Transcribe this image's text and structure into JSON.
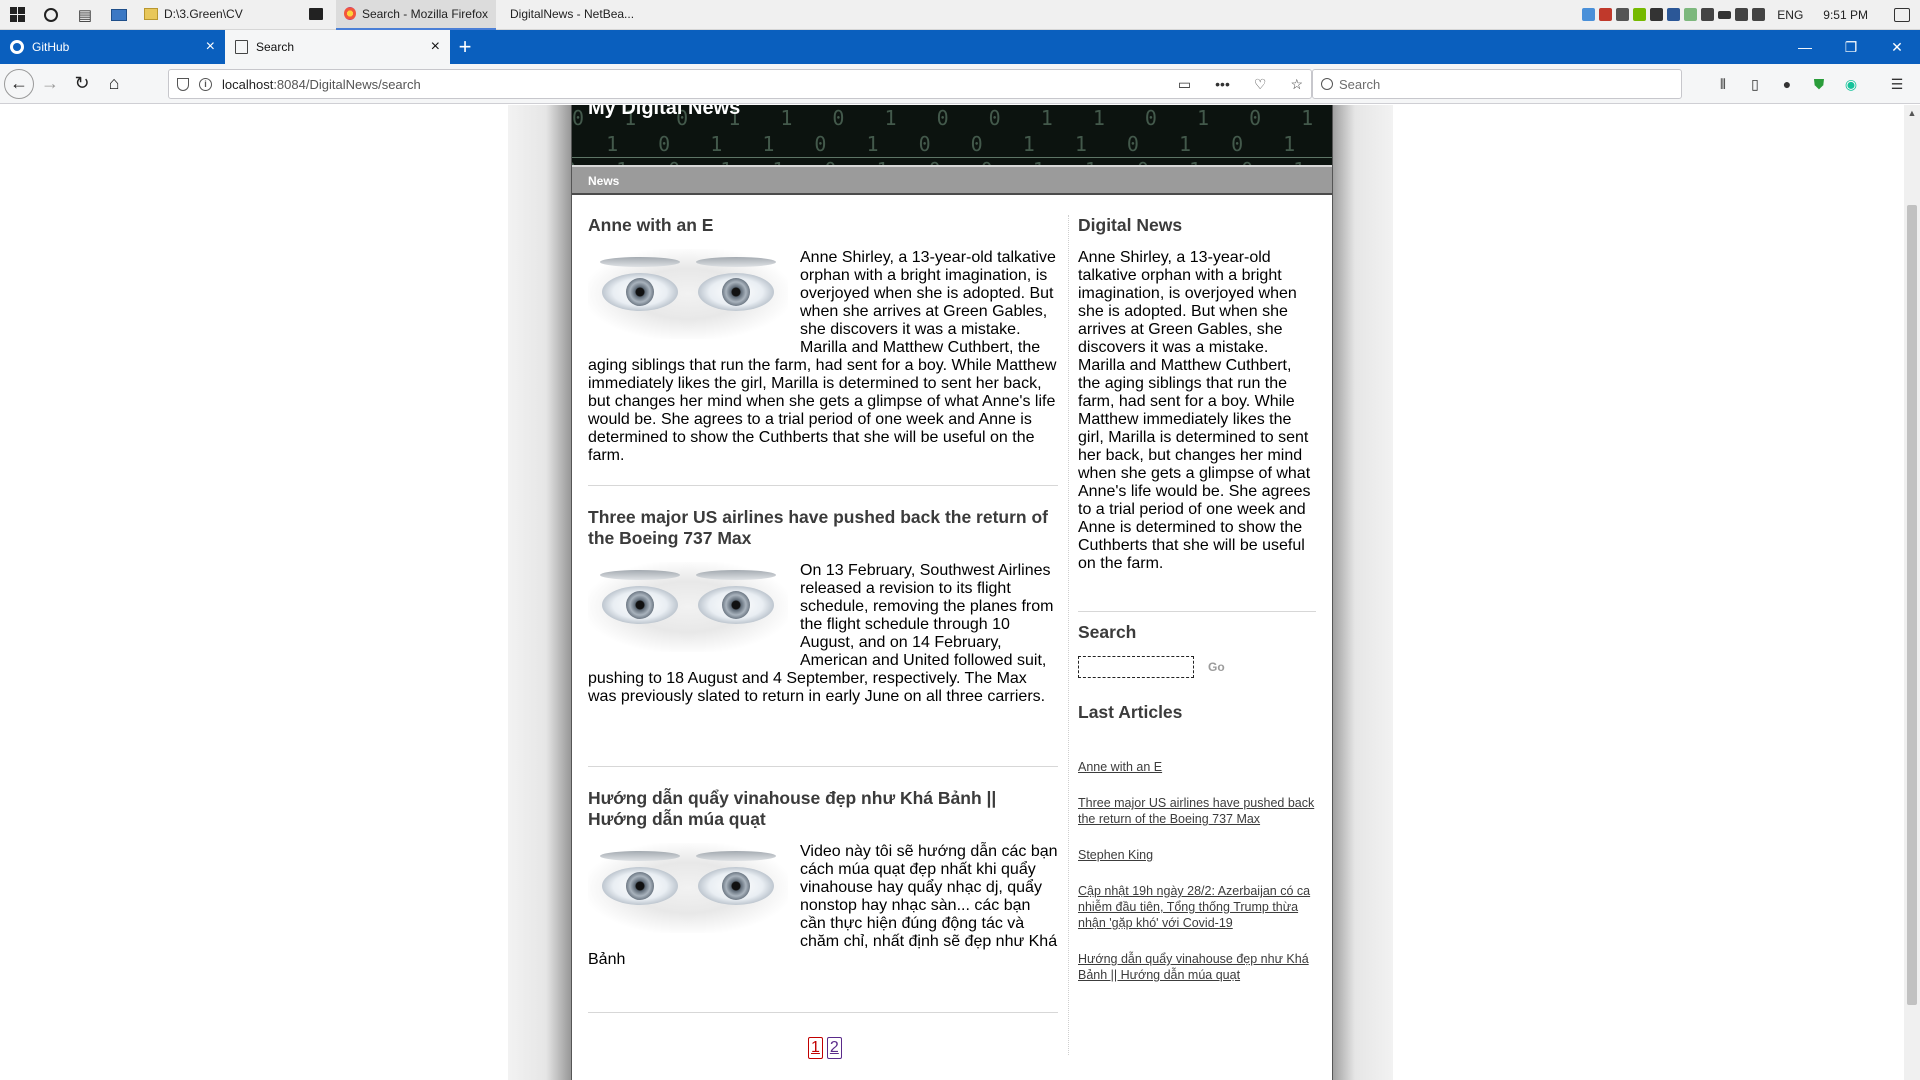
{
  "taskbar": {
    "tasks": [
      {
        "label": "D:\\3.Green\\CV"
      },
      {
        "label": ""
      },
      {
        "label": "Search - Mozilla Firefox"
      },
      {
        "label": "DigitalNews - NetBea..."
      }
    ],
    "language": "ENG",
    "time": "9:51 PM"
  },
  "browser": {
    "tabs": [
      {
        "label": "GitHub",
        "close": "×"
      },
      {
        "label": "Search",
        "close": "×"
      }
    ],
    "new_tab": "+",
    "window_controls": {
      "minimize": "—",
      "restore": "❐",
      "close": "✕"
    },
    "url_host": "localhost",
    "url_rest": ":8084/DigitalNews/search",
    "search_placeholder": "Search"
  },
  "site": {
    "title": "My Digital News",
    "header_pattern": "0 1 0 1 1 0 1 0 0 1 1 0 1 0 1 1 0 1 0 0 1 0 1 1 0",
    "menu": {
      "news": "News"
    }
  },
  "articles": [
    {
      "title": "Anne with an E",
      "text": "Anne Shirley, a 13-year-old talkative orphan with a bright imagination, is overjoyed when she is adopted. But when she arrives at Green Gables, she discovers it was a mistake. Marilla and Matthew Cuthbert, the aging siblings that run the farm, had sent for a boy. While Matthew immediately likes the girl, Marilla is determined to sent her back, but changes her mind when she gets a glimpse of what Anne's life would be. She agrees to a trial period of one week and Anne is determined to show the Cuthberts that she will be useful on the farm."
    },
    {
      "title": "Three major US airlines have pushed back the return of the Boeing 737 Max",
      "text": "On 13 February, Southwest Airlines released a revision to its flight schedule, removing the planes from the flight schedule through 10 August, and on 14 February, American and United followed suit, pushing to 18 August and 4 September, respectively. The Max was previously slated to return in early June on all three carriers."
    },
    {
      "title": "Hướng dẫn quẩy vinahouse đẹp như Khá Bảnh || Hướng dẫn múa quạt",
      "text": "Video này tôi sẽ hướng dẫn các bạn cách múa quạt đẹp nhất khi quẩy vinahouse hay quẩy nhạc dj, quẩy nonstop hay nhạc sàn... các bạn cần thực hiện đúng động tác và chăm chỉ, nhất định sẽ đẹp như Khá Bảnh"
    }
  ],
  "pagination": {
    "pages": [
      "1",
      "2"
    ]
  },
  "sidebar": {
    "about_title": "Digital News",
    "about_text": "Anne Shirley, a 13-year-old talkative orphan with a bright imagination, is overjoyed when she is adopted. But when she arrives at Green Gables, she discovers it was a mistake. Marilla and Matthew Cuthbert, the aging siblings that run the farm, had sent for a boy. While Matthew immediately likes the girl, Marilla is determined to sent her back, but changes her mind when she gets a glimpse of what Anne's life would be. She agrees to a trial period of one week and Anne is determined to show the Cuthberts that she will be useful on the farm.",
    "search_title": "Search",
    "search_value": "",
    "go_label": "Go",
    "last_title": "Last Articles",
    "last_articles": [
      "Anne with an E",
      "Three major US airlines have pushed back the return of the Boeing 737 Max",
      "Stephen King",
      "Cập nhật 19h ngày 28/2: Azerbaijan có ca nhiễm đầu tiên, Tổng thống Trump thừa nhận 'gặp khó' với Covid-19",
      "Hướng dẫn quẩy vinahouse đẹp như Khá Bảnh || Hướng dẫn múa quạt"
    ]
  },
  "colors": {
    "firefox_blue": "#0a5fbe",
    "menu_gray": "#9b9b9b",
    "heading_gray": "#3b3b3b",
    "page_active_red": "#c20000"
  }
}
